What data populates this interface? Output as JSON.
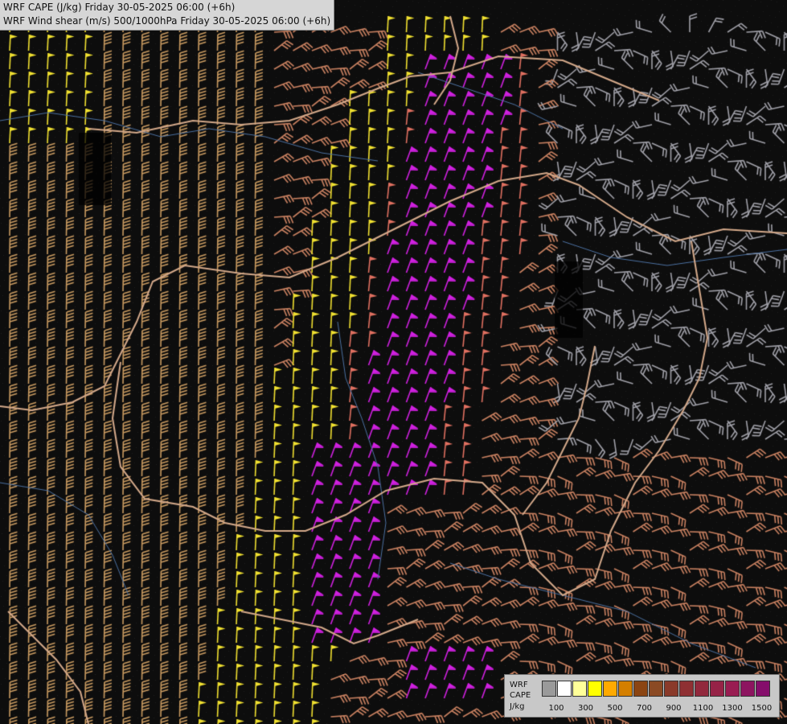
{
  "header": {
    "line1": "WRF CAPE (J/kg) Friday 30-05-2025 06:00 (+6h)",
    "line2": "WRF Wind shear (m/s) 500/1000hPa Friday 30-05-2025 06:00 (+6h)"
  },
  "legend": {
    "title_line1": "WRF",
    "title_line2": "CAPE",
    "title_line3": "J/kg",
    "swatch_colors": [
      "#9a9a9a",
      "#ffffff",
      "#ffff99",
      "#ffff00",
      "#ffaa00",
      "#d47f00",
      "#8b4513",
      "#8b4a24",
      "#8a3a2a",
      "#8f3033",
      "#92293d",
      "#962347",
      "#991d52",
      "#8d1560",
      "#850d6b"
    ],
    "ticks": [
      "100",
      "300",
      "500",
      "700",
      "900",
      "1100",
      "1300",
      "1500"
    ]
  },
  "colors": {
    "background": "#0d0d0d",
    "border": "#d4a98a",
    "river": "#4a6fa0",
    "barb_low": "#c0a0b0",
    "barb_mid": "#c88060",
    "barb_tan": "#c89a60",
    "barb_yellow": "#f0e030",
    "barb_salmon": "#e07060",
    "barb_magenta": "#d020e0",
    "barb_gray": "#a0a0a8"
  }
}
